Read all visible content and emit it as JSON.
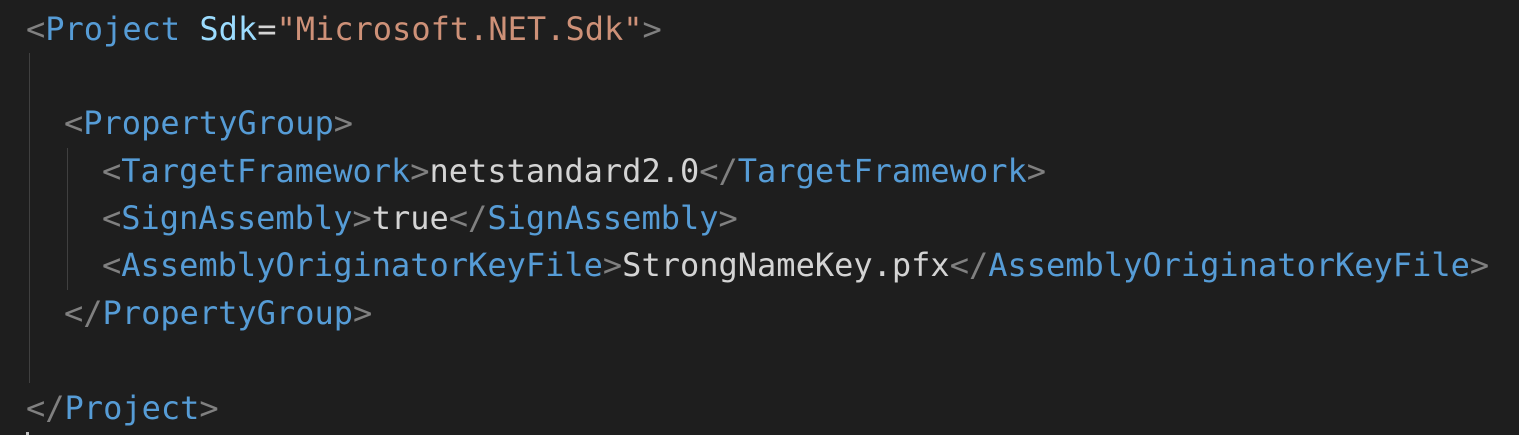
{
  "editor": {
    "lines": [
      {
        "open": "<",
        "tag": "Project",
        "attr_name": "Sdk",
        "eq": "=",
        "attr_value": "\"Microsoft.NET.Sdk\"",
        "close": ">"
      },
      {},
      {
        "open": "<",
        "tag": "PropertyGroup",
        "close": ">"
      },
      {
        "open": "<",
        "tag": "TargetFramework",
        "close": ">",
        "text": "netstandard2.0",
        "end_open": "</",
        "end_tag": "TargetFramework",
        "end_close": ">"
      },
      {
        "open": "<",
        "tag": "SignAssembly",
        "close": ">",
        "text": "true",
        "end_open": "</",
        "end_tag": "SignAssembly",
        "end_close": ">"
      },
      {
        "open": "<",
        "tag": "AssemblyOriginatorKeyFile",
        "close": ">",
        "text": "StrongNameKey.pfx",
        "end_open": "</",
        "end_tag": "AssemblyOriginatorKeyFile",
        "end_close": ">"
      },
      {
        "open": "</",
        "tag": "PropertyGroup",
        "close": ">"
      },
      {},
      {
        "open": "</",
        "tag": "Project",
        "close": ">"
      }
    ]
  },
  "colors": {
    "background": "#1e1e1e",
    "punctuation": "#808080",
    "tag": "#569cd6",
    "attribute": "#9cdcfe",
    "string": "#ce9178",
    "text": "#d4d4d4",
    "indent_guide": "#404040"
  }
}
